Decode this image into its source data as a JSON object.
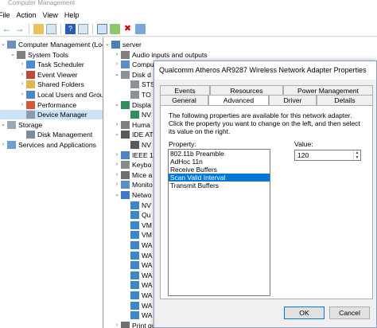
{
  "window": {
    "title": "Computer Management"
  },
  "menu": {
    "file": "File",
    "action": "Action",
    "view": "View",
    "help": "Help"
  },
  "left_tree": [
    {
      "label": "Computer Management (Local",
      "icon": "computer-management-icon",
      "indent": 0,
      "arrow": "v"
    },
    {
      "label": "System Tools",
      "icon": "tools-icon",
      "indent": 1,
      "arrow": "v"
    },
    {
      "label": "Task Scheduler",
      "icon": "clock-icon",
      "indent": 2,
      "arrow": ">"
    },
    {
      "label": "Event Viewer",
      "icon": "event-viewer-icon",
      "indent": 2,
      "arrow": ">"
    },
    {
      "label": "Shared Folders",
      "icon": "shared-folder-icon",
      "indent": 2,
      "arrow": ">"
    },
    {
      "label": "Local Users and Groups",
      "icon": "users-icon",
      "indent": 2,
      "arrow": ">"
    },
    {
      "label": "Performance",
      "icon": "performance-icon",
      "indent": 2,
      "arrow": ">"
    },
    {
      "label": "Device Manager",
      "icon": "device-manager-icon",
      "indent": 2,
      "arrow": "",
      "selected": true
    },
    {
      "label": "Storage",
      "icon": "storage-icon",
      "indent": 0,
      "arrow": "v"
    },
    {
      "label": "Disk Management",
      "icon": "disk-icon",
      "indent": 2,
      "arrow": ""
    },
    {
      "label": "Services and Applications",
      "icon": "services-icon",
      "indent": 0,
      "arrow": ">"
    }
  ],
  "right_tree": [
    {
      "label": "server",
      "icon": "computer-icon",
      "indent": 0,
      "arrow": "v"
    },
    {
      "label": "Audio inputs and outputs",
      "icon": "audio-icon",
      "indent": 1,
      "arrow": ">"
    },
    {
      "label": "Compu",
      "icon": "monitor-icon",
      "indent": 1,
      "arrow": ">"
    },
    {
      "label": "Disk d",
      "icon": "disk-drive-icon",
      "indent": 1,
      "arrow": "v"
    },
    {
      "label": "STS",
      "icon": "disk-drive-icon",
      "indent": 2,
      "arrow": ""
    },
    {
      "label": "TO",
      "icon": "disk-drive-icon",
      "indent": 2,
      "arrow": ""
    },
    {
      "label": "Displa",
      "icon": "display-adapter-icon",
      "indent": 1,
      "arrow": "v"
    },
    {
      "label": "NV",
      "icon": "display-adapter-icon",
      "indent": 2,
      "arrow": ""
    },
    {
      "label": "Huma",
      "icon": "hid-icon",
      "indent": 1,
      "arrow": ">"
    },
    {
      "label": "IDE AT",
      "icon": "ide-icon",
      "indent": 1,
      "arrow": "v"
    },
    {
      "label": "NV",
      "icon": "ide-icon",
      "indent": 2,
      "arrow": ""
    },
    {
      "label": "IEEE 13",
      "icon": "ieee-icon",
      "indent": 1,
      "arrow": ">"
    },
    {
      "label": "Keybo",
      "icon": "keyboard-icon",
      "indent": 1,
      "arrow": ">"
    },
    {
      "label": "Mice a",
      "icon": "mouse-icon",
      "indent": 1,
      "arrow": ">"
    },
    {
      "label": "Monito",
      "icon": "monitor-icon",
      "indent": 1,
      "arrow": ">"
    },
    {
      "label": "Netwo",
      "icon": "network-icon",
      "indent": 1,
      "arrow": "v"
    },
    {
      "label": "NV",
      "icon": "network-adapter-icon",
      "indent": 2,
      "arrow": ""
    },
    {
      "label": "Qu",
      "icon": "network-adapter-icon",
      "indent": 2,
      "arrow": ""
    },
    {
      "label": "VM",
      "icon": "network-adapter-icon",
      "indent": 2,
      "arrow": ""
    },
    {
      "label": "VM",
      "icon": "network-adapter-icon",
      "indent": 2,
      "arrow": ""
    },
    {
      "label": "WA",
      "icon": "network-adapter-icon",
      "indent": 2,
      "arrow": ""
    },
    {
      "label": "WA",
      "icon": "network-adapter-icon",
      "indent": 2,
      "arrow": ""
    },
    {
      "label": "WA",
      "icon": "network-adapter-icon",
      "indent": 2,
      "arrow": ""
    },
    {
      "label": "WA",
      "icon": "network-adapter-icon",
      "indent": 2,
      "arrow": ""
    },
    {
      "label": "WA",
      "icon": "network-adapter-icon",
      "indent": 2,
      "arrow": ""
    },
    {
      "label": "WA",
      "icon": "network-adapter-icon",
      "indent": 2,
      "arrow": ""
    },
    {
      "label": "WA",
      "icon": "network-adapter-icon",
      "indent": 2,
      "arrow": ""
    },
    {
      "label": "WA",
      "icon": "network-adapter-icon",
      "indent": 2,
      "arrow": ""
    },
    {
      "label": "Print queues",
      "icon": "printer-icon",
      "indent": 1,
      "arrow": ">"
    }
  ],
  "dialog": {
    "title": "Qualcomm Atheros AR9287 Wireless Network Adapter Properties",
    "tabs_row1": [
      "Events",
      "Resources",
      "Power Management"
    ],
    "tabs_row2": [
      "General",
      "Advanced",
      "Driver",
      "Details"
    ],
    "active_tab": "Advanced",
    "description": "The following properties are available for this network adapter. Click the property you want to change on the left, and then select its value on the right.",
    "property_label": "Property:",
    "value_label": "Value:",
    "properties": [
      "802.11b Preamble",
      "AdHoc 11n",
      "Receive Buffers",
      "Scan Valid Interval",
      "Transmit Buffers"
    ],
    "selected_property": "Scan Valid Interval",
    "value": "120",
    "ok_label": "OK",
    "cancel_label": "Cancel"
  },
  "colors": {
    "selection": "#0078d7",
    "tree_selection": "#cce4f7"
  }
}
